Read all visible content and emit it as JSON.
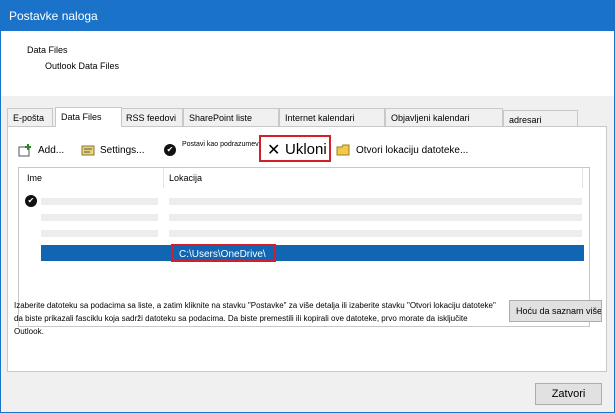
{
  "window": {
    "title": "Postavke naloga"
  },
  "header": {
    "line1": "Data Files",
    "line2": "Outlook Data Files"
  },
  "tabs": [
    {
      "label": "E-pošta"
    },
    {
      "label": "Data Files"
    },
    {
      "label": "RSS feedovi"
    },
    {
      "label": "SharePoint liste"
    },
    {
      "label": "Internet kalendari"
    },
    {
      "label": "Objavljeni kalendari"
    },
    {
      "label": "adresari"
    }
  ],
  "toolbar": {
    "add": "Add...",
    "settings": "Settings...",
    "default": "Postavi kao podrazumevano",
    "remove": "Ukloni",
    "open_location": "Otvori lokaciju datoteke..."
  },
  "grid": {
    "col_name": "Ime",
    "col_location": "Lokacija",
    "selected_location": "C:\\Users\\OneDrive\\"
  },
  "description": "Izaberite datoteku sa podacima sa liste, a zatim kliknite na stavku \"Postavke\" za više detalja ili izaberite stavku \"Otvori lokaciju datoteke\" da biste prikazali fasciklu koja sadrži datoteku sa podacima. Da biste premestili ili kopirali ove datoteke, prvo morate da isključite Outlook.",
  "buttons": {
    "more": "Hoću da saznam više...",
    "close": "Zatvori"
  },
  "colors": {
    "titlebar": "#1a73c8",
    "selection": "#1166b4",
    "highlight": "#d21f2b"
  }
}
